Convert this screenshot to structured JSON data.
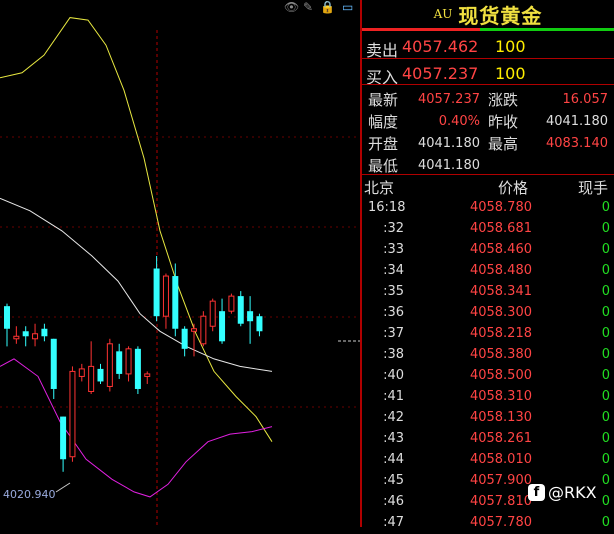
{
  "chart": {
    "low_label": "4020.940",
    "candles": [
      {
        "o": 4049.5,
        "c": 4054.0,
        "h": 4054.5,
        "l": 4046.0,
        "up": false
      },
      {
        "o": 4048.0,
        "c": 4047.5,
        "h": 4050.0,
        "l": 4046.5,
        "up": true
      },
      {
        "o": 4049.0,
        "c": 4048.0,
        "h": 4050.0,
        "l": 4046.0,
        "up": false
      },
      {
        "o": 4048.5,
        "c": 4047.5,
        "h": 4050.5,
        "l": 4046.0,
        "up": true
      },
      {
        "o": 4049.5,
        "c": 4048.0,
        "h": 4050.5,
        "l": 4047.0,
        "up": false
      },
      {
        "o": 4047.5,
        "c": 4037.5,
        "h": 4047.5,
        "l": 4035.5,
        "up": false
      },
      {
        "o": 4032.0,
        "c": 4023.5,
        "h": 4032.0,
        "l": 4021.0,
        "up": false
      },
      {
        "o": 4024.0,
        "c": 4041.0,
        "h": 4042.0,
        "l": 4023.0,
        "up": true
      },
      {
        "o": 4040.0,
        "c": 4041.5,
        "h": 4042.5,
        "l": 4039.0,
        "up": true
      },
      {
        "o": 4037.0,
        "c": 4042.0,
        "h": 4047.0,
        "l": 4036.5,
        "up": true
      },
      {
        "o": 4039.0,
        "c": 4041.5,
        "h": 4042.5,
        "l": 4038.5,
        "up": false
      },
      {
        "o": 4038.0,
        "c": 4046.5,
        "h": 4047.5,
        "l": 4037.0,
        "up": true
      },
      {
        "o": 4045.0,
        "c": 4040.5,
        "h": 4046.5,
        "l": 4039.5,
        "up": false
      },
      {
        "o": 4040.5,
        "c": 4045.5,
        "h": 4046.0,
        "l": 4039.0,
        "up": true
      },
      {
        "o": 4045.5,
        "c": 4037.5,
        "h": 4046.0,
        "l": 4036.5,
        "up": false
      },
      {
        "o": 4040.0,
        "c": 4040.5,
        "h": 4041.0,
        "l": 4038.5,
        "up": true
      },
      {
        "o": 4061.5,
        "c": 4052.0,
        "h": 4064.0,
        "l": 4051.0,
        "up": false
      },
      {
        "o": 4052.0,
        "c": 4060.0,
        "h": 4060.5,
        "l": 4049.5,
        "up": true
      },
      {
        "o": 4060.0,
        "c": 4049.5,
        "h": 4062.5,
        "l": 4048.0,
        "up": false
      },
      {
        "o": 4049.5,
        "c": 4045.5,
        "h": 4050.0,
        "l": 4044.0,
        "up": false
      },
      {
        "o": 4049.0,
        "c": 4049.5,
        "h": 4050.5,
        "l": 4044.0,
        "up": true
      },
      {
        "o": 4046.5,
        "c": 4052.0,
        "h": 4053.0,
        "l": 4046.0,
        "up": true
      },
      {
        "o": 4050.0,
        "c": 4055.0,
        "h": 4055.5,
        "l": 4049.0,
        "up": true
      },
      {
        "o": 4053.0,
        "c": 4047.0,
        "h": 4055.5,
        "l": 4046.5,
        "up": false
      },
      {
        "o": 4053.0,
        "c": 4056.0,
        "h": 4056.5,
        "l": 4052.5,
        "up": true
      },
      {
        "o": 4056.0,
        "c": 4050.5,
        "h": 4057.0,
        "l": 4050.0,
        "up": false
      },
      {
        "o": 4053.0,
        "c": 4051.0,
        "h": 4056.0,
        "l": 4046.5,
        "up": false
      },
      {
        "o": 4052.0,
        "c": 4049.0,
        "h": 4052.5,
        "l": 4048.0,
        "up": false
      }
    ],
    "ma_yellow": [
      [
        0,
        4099.5
      ],
      [
        22,
        4100.5
      ],
      [
        44,
        4104.0
      ],
      [
        70,
        4111.5
      ],
      [
        88,
        4111.0
      ],
      [
        106,
        4106.0
      ],
      [
        124,
        4097.0
      ],
      [
        144,
        4083.5
      ],
      [
        160,
        4069.0
      ],
      [
        178,
        4058.0
      ],
      [
        196,
        4048.5
      ],
      [
        214,
        4041.0
      ],
      [
        236,
        4036.0
      ],
      [
        256,
        4032.0
      ],
      [
        272,
        4027.0
      ]
    ],
    "ma_white": [
      [
        0,
        4075.5
      ],
      [
        30,
        4073.0
      ],
      [
        62,
        4069.0
      ],
      [
        92,
        4064.0
      ],
      [
        118,
        4059.0
      ],
      [
        140,
        4052.5
      ],
      [
        160,
        4049.0
      ],
      [
        186,
        4046.0
      ],
      [
        214,
        4043.5
      ],
      [
        240,
        4042.0
      ],
      [
        272,
        4041.0
      ]
    ],
    "ma_magenta": [
      [
        0,
        4042.0
      ],
      [
        14,
        4043.5
      ],
      [
        38,
        4040.0
      ],
      [
        60,
        4031.0
      ],
      [
        86,
        4023.5
      ],
      [
        112,
        4019.5
      ],
      [
        134,
        4017.0
      ],
      [
        150,
        4016.0
      ],
      [
        168,
        4018.5
      ],
      [
        186,
        4023.0
      ],
      [
        208,
        4027.0
      ],
      [
        230,
        4028.5
      ],
      [
        252,
        4029.0
      ],
      [
        272,
        4030.0
      ]
    ]
  },
  "quote": {
    "code": "AU",
    "name": "现货黄金",
    "sell_label": "卖出",
    "sell_price": "4057.462",
    "sell_vol": "100",
    "buy_label": "买入",
    "buy_price": "4057.237",
    "buy_vol": "100"
  },
  "stats": [
    {
      "k1": "最新",
      "v1": "4057.237",
      "c1": "red",
      "k2": "涨跌",
      "v2": "16.057",
      "c2": "red"
    },
    {
      "k1": "幅度",
      "v1": "0.40%",
      "c1": "red",
      "k2": "昨收",
      "v2": "4041.180",
      "c2": "white"
    },
    {
      "k1": "开盘",
      "v1": "4041.180",
      "c1": "white",
      "k2": "最高",
      "v2": "4083.140",
      "c2": "red"
    },
    {
      "k1": "最低",
      "v1": "4041.180",
      "c1": "white",
      "k2": "",
      "v2": "",
      "c2": "white"
    }
  ],
  "ticks_header": {
    "time": "北京",
    "price": "价格",
    "vol": "现手"
  },
  "ticks": [
    {
      "t": "16:18",
      "p": "4058.780",
      "v": "0"
    },
    {
      "t": ":32",
      "p": "4058.681",
      "v": "0"
    },
    {
      "t": ":33",
      "p": "4058.460",
      "v": "0"
    },
    {
      "t": ":34",
      "p": "4058.480",
      "v": "0"
    },
    {
      "t": ":35",
      "p": "4058.341",
      "v": "0"
    },
    {
      "t": ":36",
      "p": "4058.300",
      "v": "0"
    },
    {
      "t": ":37",
      "p": "4058.218",
      "v": "0"
    },
    {
      "t": ":38",
      "p": "4058.380",
      "v": "0"
    },
    {
      "t": ":40",
      "p": "4058.500",
      "v": "0"
    },
    {
      "t": ":41",
      "p": "4058.310",
      "v": "0"
    },
    {
      "t": ":42",
      "p": "4058.130",
      "v": "0"
    },
    {
      "t": ":43",
      "p": "4058.261",
      "v": "0"
    },
    {
      "t": ":44",
      "p": "4058.010",
      "v": "0"
    },
    {
      "t": ":45",
      "p": "4057.900",
      "v": "0"
    },
    {
      "t": ":46",
      "p": "4057.810",
      "v": "0"
    },
    {
      "t": ":47",
      "p": "4057.780",
      "v": "0"
    }
  ],
  "watermark": "@RKX",
  "watermark_icon": "f"
}
